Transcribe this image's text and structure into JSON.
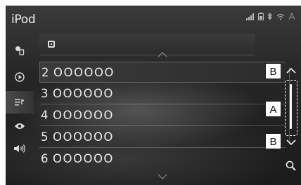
{
  "app": {
    "title": "iPod"
  },
  "list": {
    "items": [
      {
        "number": "2",
        "name": "OOOOOO"
      },
      {
        "number": "3",
        "name": "OOOOOO"
      },
      {
        "number": "4",
        "name": "OOOOOO"
      },
      {
        "number": "5",
        "name": "OOOOOO"
      },
      {
        "number": "6",
        "name": "OOOOOO"
      }
    ]
  },
  "callouts": {
    "a": "A",
    "b_top": "B",
    "b_bottom": "B"
  },
  "sidebar": {
    "icons": [
      "source-icon",
      "play-icon",
      "list-icon",
      "eye-icon",
      "volume-icon"
    ],
    "active_index": 2
  },
  "status_icons": [
    "signal-icon",
    "battery-icon",
    "bluetooth-icon",
    "wifi-icon",
    "antenna-icon"
  ],
  "colors": {
    "background": "#262626",
    "text": "#eaeaea",
    "callout_bg": "#ffffff"
  }
}
